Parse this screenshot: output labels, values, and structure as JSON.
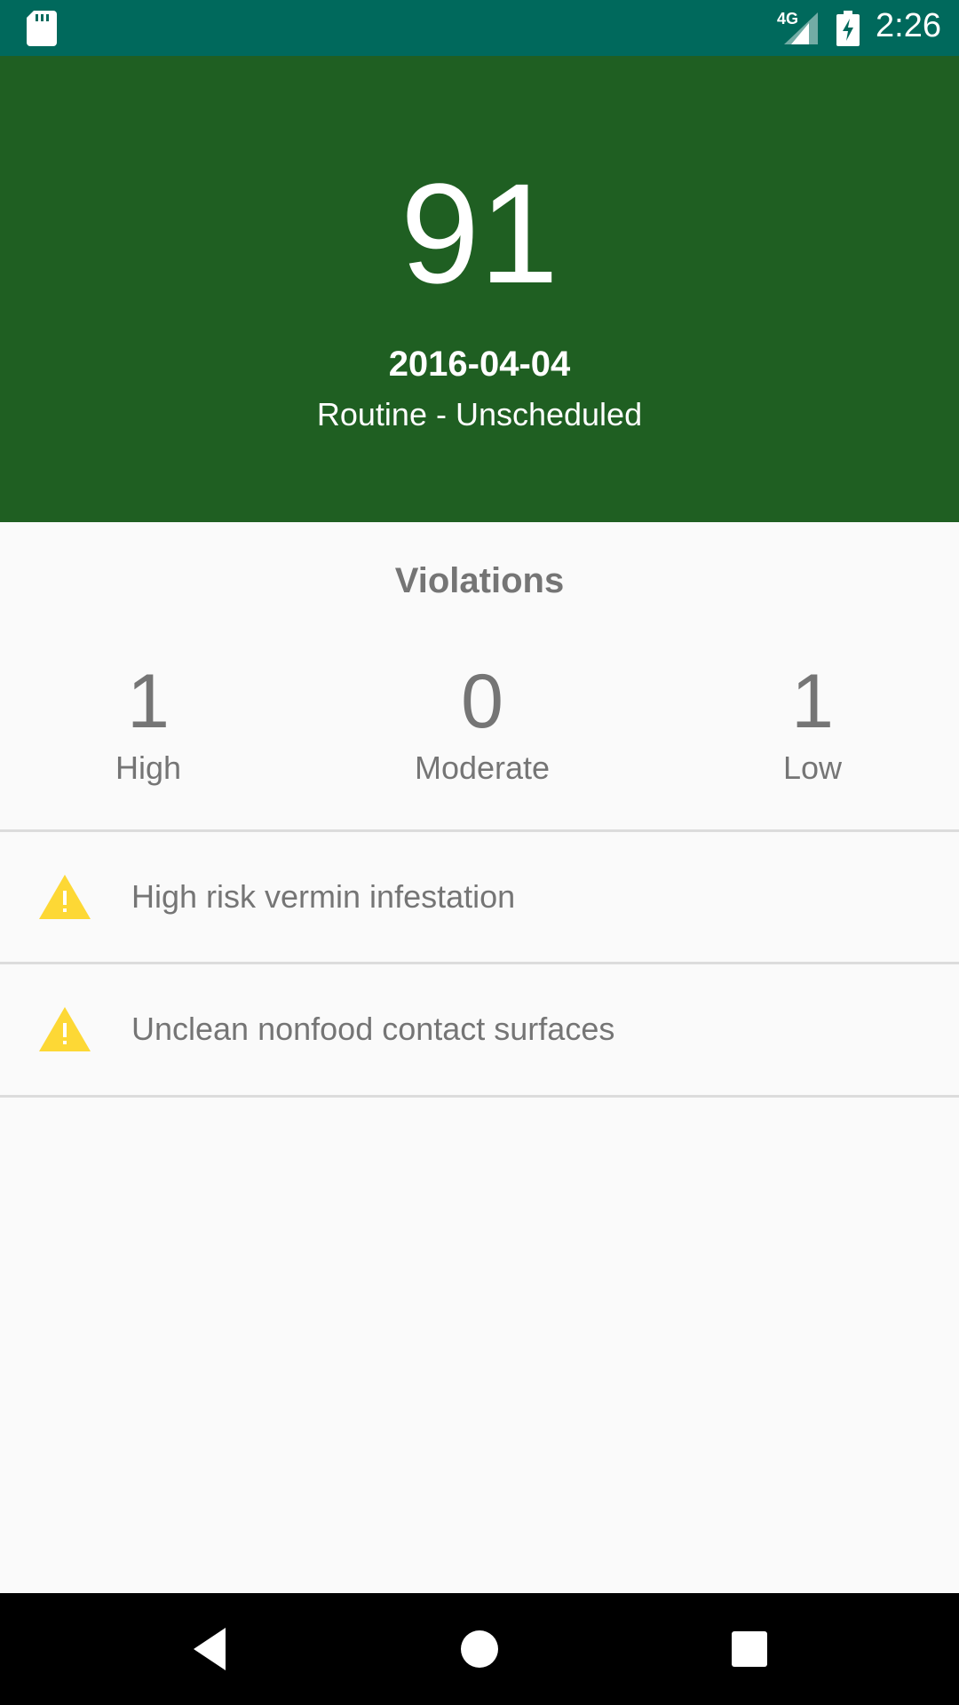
{
  "status_bar": {
    "network": "4G",
    "time": "2:26",
    "icons": [
      "sd-card-icon",
      "signal-icon",
      "battery-charging-icon"
    ]
  },
  "inspection": {
    "score": "91",
    "date": "2016-04-04",
    "type": "Routine - Unscheduled",
    "color": "#1f5f22"
  },
  "violations": {
    "title": "Violations",
    "counts": [
      {
        "value": "1",
        "label": "High"
      },
      {
        "value": "0",
        "label": "Moderate"
      },
      {
        "value": "1",
        "label": "Low"
      }
    ],
    "items": [
      {
        "icon": "warning-icon",
        "text": "High risk vermin infestation"
      },
      {
        "icon": "warning-icon",
        "text": "Unclean nonfood contact surfaces"
      }
    ],
    "warning_color": "#fdd835"
  },
  "nav_bar": {
    "icons": [
      "back-icon",
      "home-icon",
      "recents-icon"
    ]
  }
}
